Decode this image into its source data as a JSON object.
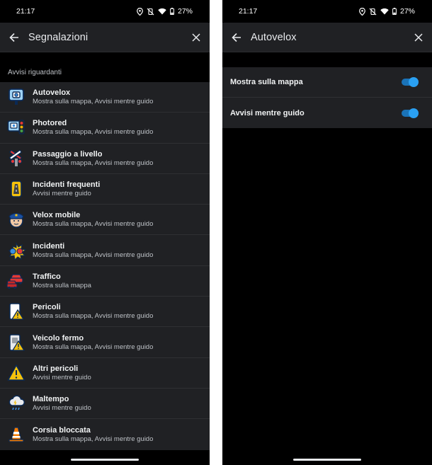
{
  "left": {
    "status": {
      "time": "21:17",
      "battery": "27%"
    },
    "appbar": {
      "title": "Segnalazioni"
    },
    "section_label": "Avvisi riguardanti",
    "items": [
      {
        "title": "Autovelox",
        "subtitle": "Mostra sulla mappa, Avvisi mentre guido",
        "icon": "speed-camera-icon"
      },
      {
        "title": "Photored",
        "subtitle": "Mostra sulla mappa, Avvisi mentre guido",
        "icon": "red-light-camera-icon"
      },
      {
        "title": "Passaggio a livello",
        "subtitle": "Mostra sulla mappa, Avvisi mentre guido",
        "icon": "railroad-crossing-icon"
      },
      {
        "title": "Incidenti frequenti",
        "subtitle": "Avvisi mentre guido",
        "icon": "frequent-accidents-icon"
      },
      {
        "title": "Velox mobile",
        "subtitle": "Mostra sulla mappa, Avvisi mentre guido",
        "icon": "police-officer-icon"
      },
      {
        "title": "Incidenti",
        "subtitle": "Mostra sulla mappa, Avvisi mentre guido",
        "icon": "crash-icon"
      },
      {
        "title": "Traffico",
        "subtitle": "Mostra sulla mappa",
        "icon": "traffic-cars-icon"
      },
      {
        "title": "Pericoli",
        "subtitle": "Mostra sulla mappa, Avvisi mentre guido",
        "icon": "hazard-icon"
      },
      {
        "title": "Veicolo fermo",
        "subtitle": "Mostra sulla mappa, Avvisi mentre guido",
        "icon": "stopped-vehicle-icon"
      },
      {
        "title": "Altri pericoli",
        "subtitle": "Avvisi mentre guido",
        "icon": "warning-triangle-icon"
      },
      {
        "title": "Maltempo",
        "subtitle": "Avvisi mentre guido",
        "icon": "bad-weather-icon"
      },
      {
        "title": "Corsia bloccata",
        "subtitle": "Mostra sulla mappa, Avvisi mentre guido",
        "icon": "traffic-cone-icon"
      }
    ]
  },
  "right": {
    "status": {
      "time": "21:17",
      "battery": "27%"
    },
    "appbar": {
      "title": "Autovelox"
    },
    "settings": [
      {
        "label": "Mostra sulla mappa",
        "enabled": true
      },
      {
        "label": "Avvisi mentre guido",
        "enabled": true
      }
    ]
  },
  "colors": {
    "toggle_on": "#2aa0f2",
    "surface": "#202124",
    "background": "#000000"
  }
}
